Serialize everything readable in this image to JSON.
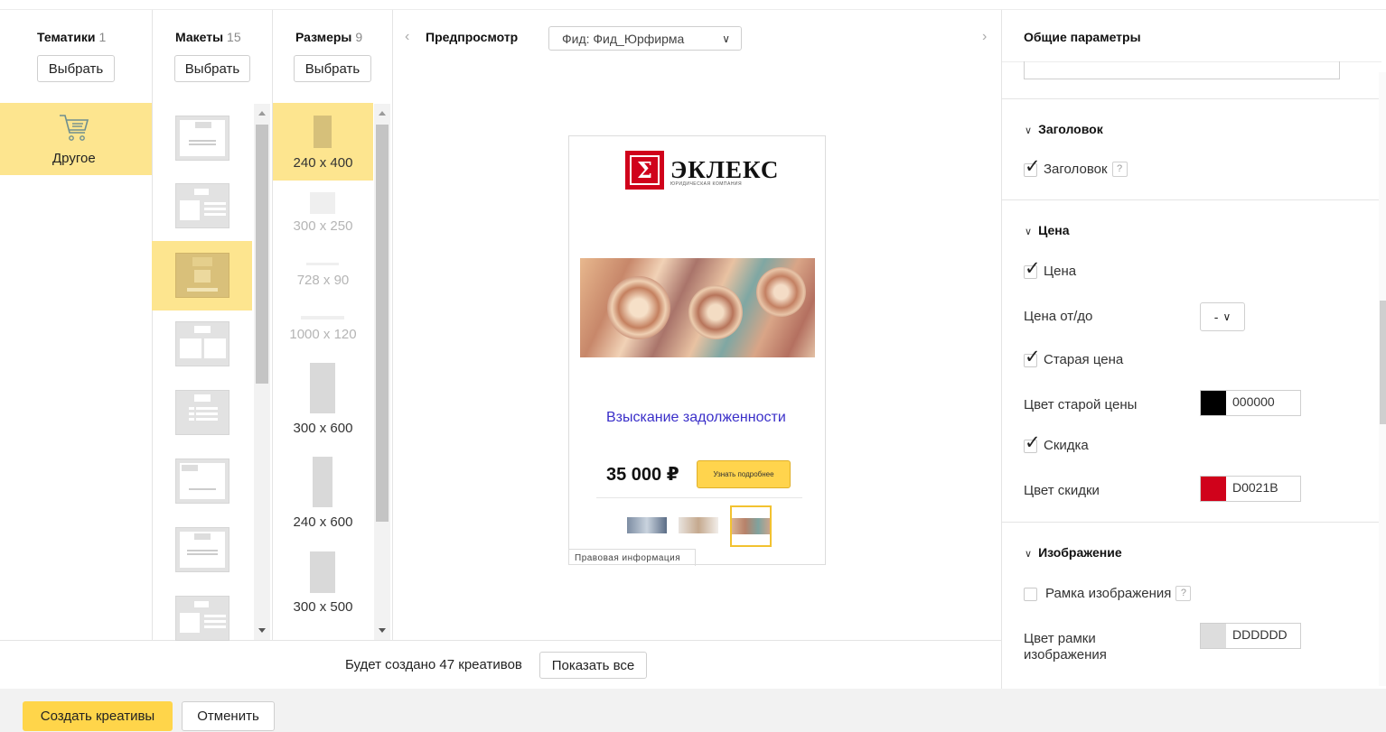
{
  "columns": {
    "themes": {
      "title": "Тематики",
      "count": "1",
      "select_label": "Выбрать",
      "items": [
        {
          "label": "Другое",
          "icon": "shopping-cart-icon"
        }
      ]
    },
    "layouts": {
      "title": "Макеты",
      "count": "15",
      "select_label": "Выбрать"
    },
    "sizes": {
      "title": "Размеры",
      "count": "9",
      "select_label": "Выбрать",
      "items": [
        {
          "label": "240 x 400",
          "selected": true
        },
        {
          "label": "300 x 250",
          "selected": false
        },
        {
          "label": "728 x 90",
          "selected": false
        },
        {
          "label": "1000 x 120",
          "selected": false
        },
        {
          "label": "300 x 600",
          "selected": false
        },
        {
          "label": "240 x 600",
          "selected": false
        },
        {
          "label": "300 x 500",
          "selected": false
        }
      ]
    }
  },
  "preview": {
    "title": "Предпросмотр",
    "feed_select": "Фид: Фид_Юрфирма",
    "ad": {
      "logo_symbol": "Σ",
      "logo_text": "ЭКЛЕКС",
      "logo_sub": "ЮРИДИЧЕСКАЯ КОМПАНИЯ",
      "title": "Взыскание задолженности",
      "price": "35 000 ₽",
      "cta": "Узнать подробнее",
      "legal": "Правовая информация"
    }
  },
  "summary": {
    "text": "Будет создано 47 креативов",
    "show_all": "Показать все"
  },
  "footer": {
    "create": "Создать креативы",
    "cancel": "Отменить"
  },
  "right_panel": {
    "title": "Общие параметры",
    "sections": {
      "heading": {
        "title": "Заголовок",
        "checkbox": "Заголовок",
        "help": "?"
      },
      "price": {
        "title": "Цена",
        "checkbox": "Цена",
        "range_label": "Цена от/до",
        "range_value": "-",
        "old_price_checkbox": "Старая цена",
        "old_price_color_label": "Цвет старой цены",
        "old_price_color": "000000",
        "discount_checkbox": "Скидка",
        "discount_color_label": "Цвет скидки",
        "discount_color": "D0021B"
      },
      "image": {
        "title": "Изображение",
        "frame_checkbox": "Рамка изображения",
        "help": "?",
        "frame_color_label": "Цвет рамки изображения",
        "frame_color": "DDDDDD"
      }
    }
  },
  "colors": {
    "accent": "#ffd54a",
    "selection": "#fde58f",
    "link": "#3a2fc9",
    "discount": "#D0021B",
    "old_price": "#000000",
    "frame": "#DDDDDD"
  }
}
